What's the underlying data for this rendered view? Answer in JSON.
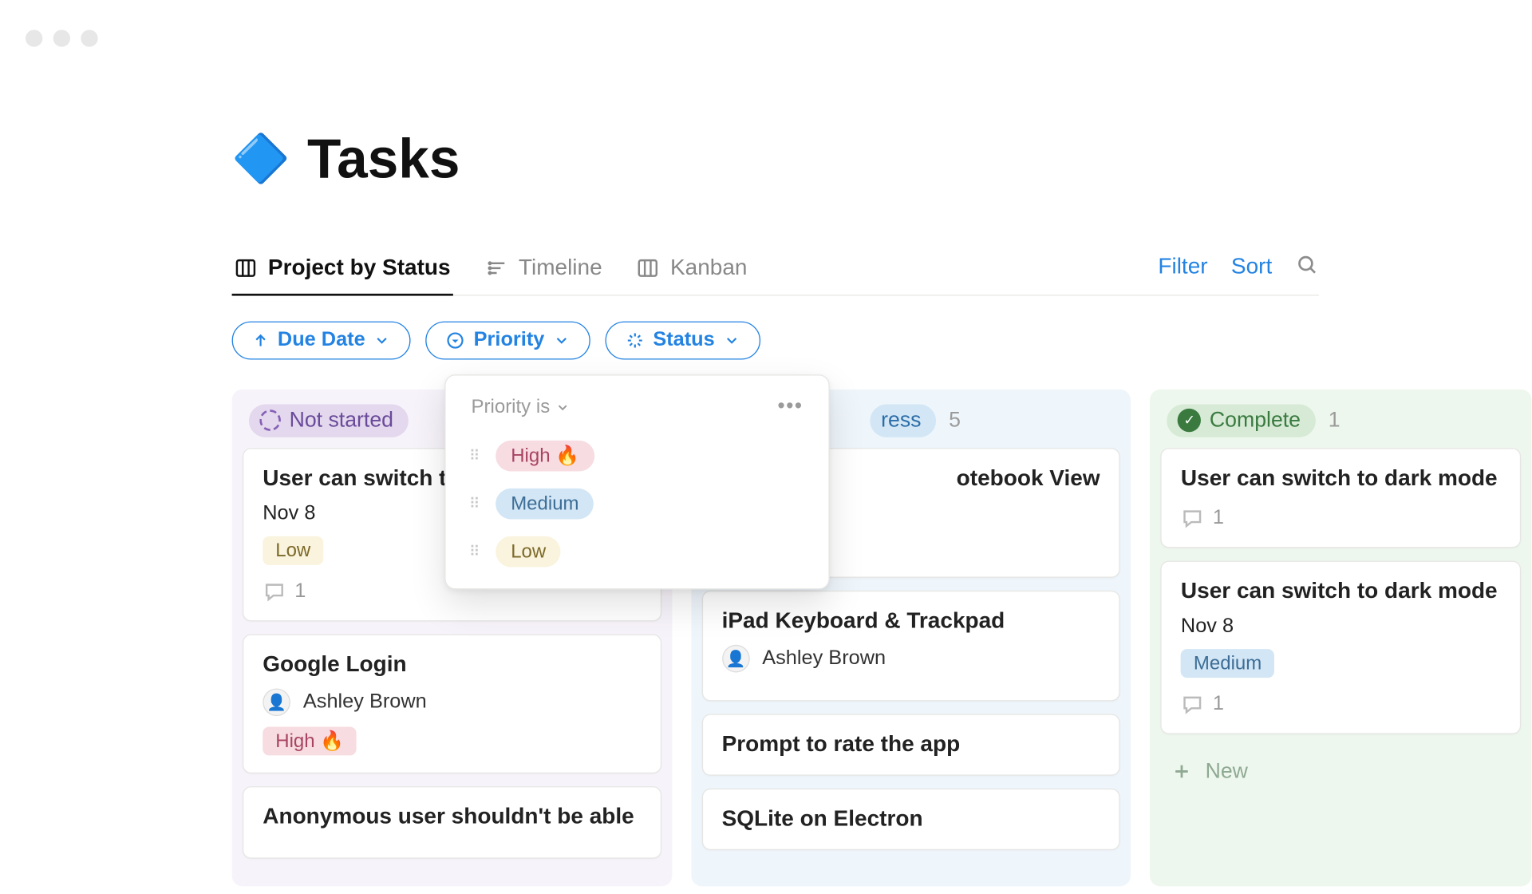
{
  "page": {
    "icon": "🔷",
    "title": "Tasks"
  },
  "views": {
    "tabs": [
      {
        "label": "Project by Status",
        "active": true
      },
      {
        "label": "Timeline",
        "active": false
      },
      {
        "label": "Kanban",
        "active": false
      }
    ],
    "filter_label": "Filter",
    "sort_label": "Sort"
  },
  "chips": {
    "due_date": "Due Date",
    "priority": "Priority",
    "status": "Status"
  },
  "priority_popover": {
    "property": "Priority",
    "operator": "is",
    "options": [
      "High 🔥",
      "Medium",
      "Low"
    ]
  },
  "columns": [
    {
      "key": "not_started",
      "label": "Not started",
      "count": "",
      "cards": [
        {
          "title": "User can switch t",
          "date": "Nov 8",
          "tag": "Low",
          "comments": "1"
        },
        {
          "title": "Google Login",
          "assignee": "Ashley Brown",
          "tag": "High 🔥"
        },
        {
          "title": "Anonymous user shouldn't be able"
        }
      ]
    },
    {
      "key": "in_progress",
      "label_suffix": "ress",
      "count": "5",
      "cards": [
        {
          "title_suffix": "otebook View"
        },
        {
          "title": "iPad Keyboard & Trackpad",
          "assignee": "Ashley Brown"
        },
        {
          "title": "Prompt to rate the app"
        },
        {
          "title": "SQLite on Electron"
        }
      ]
    },
    {
      "key": "complete",
      "label": "Complete",
      "count": "1",
      "cards": [
        {
          "title": "User can switch to dark mode",
          "comments": "1"
        },
        {
          "title": "User can switch to dark mode",
          "date": "Nov 8",
          "tag": "Medium",
          "comments": "1"
        }
      ],
      "new_label": "New"
    }
  ]
}
